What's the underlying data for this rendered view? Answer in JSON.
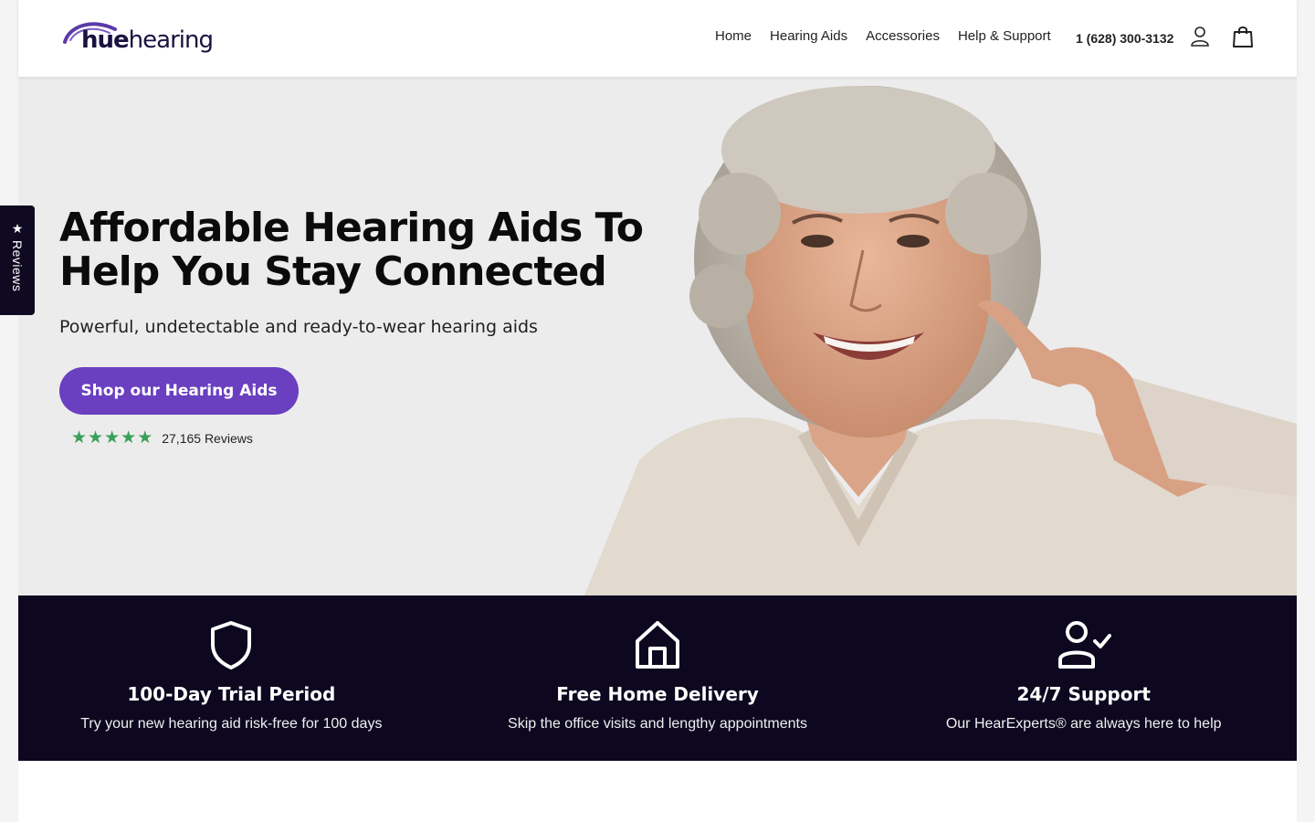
{
  "brand": {
    "logo_bold": "hue",
    "logo_light": "hearing"
  },
  "nav": {
    "items": [
      "Home",
      "Hearing Aids",
      "Accessories",
      "Help & Support"
    ],
    "phone": "1 (628) 300-3132"
  },
  "icons": {
    "account": "user-icon",
    "cart": "shopping-bag-icon",
    "trial": "shield-icon",
    "delivery": "home-icon",
    "support": "user-check-icon"
  },
  "reviews_tab": {
    "label": "Reviews"
  },
  "hero": {
    "title": "Affordable Hearing Aids To Help You Stay Connected",
    "subtitle": "Powerful, undetectable and ready-to-wear hearing aids",
    "cta": "Shop our Hearing Aids",
    "review_count": "27,165 Reviews",
    "rating_stars": 5
  },
  "benefits": [
    {
      "title": "100-Day Trial Period",
      "text": "Try your new hearing aid risk-free for 100 days"
    },
    {
      "title": "Free Home Delivery",
      "text": "Skip the office visits and lengthy appointments"
    },
    {
      "title": "24/7 Support",
      "text": "Our HearExperts® are always here to help"
    }
  ],
  "colors": {
    "accent": "#6a3fc0",
    "dark_band": "#0d0720",
    "hero_bg": "#ececec",
    "star": "#3aa05a"
  }
}
